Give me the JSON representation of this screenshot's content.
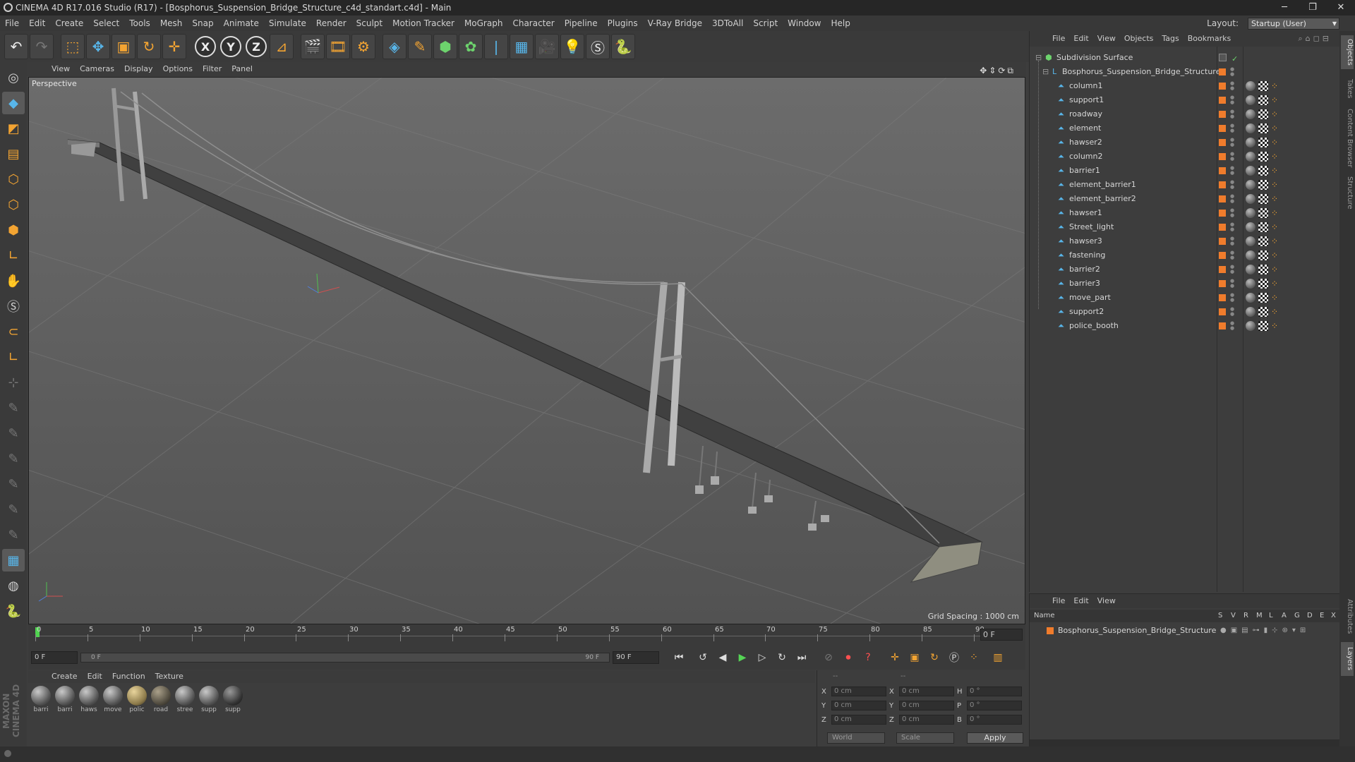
{
  "window": {
    "title": "CINEMA 4D R17.016 Studio (R17) - [Bosphorus_Suspension_Bridge_Structure_c4d_standart.c4d] - Main"
  },
  "menubar": {
    "items": [
      "File",
      "Edit",
      "Create",
      "Select",
      "Tools",
      "Mesh",
      "Snap",
      "Animate",
      "Simulate",
      "Render",
      "Sculpt",
      "Motion Tracker",
      "MoGraph",
      "Character",
      "Pipeline",
      "Plugins",
      "V-Ray Bridge",
      "3DToAll",
      "Script",
      "Window",
      "Help"
    ],
    "layout_label": "Layout:",
    "layout_value": "Startup (User)"
  },
  "toolbar": {
    "axis_x": "X",
    "axis_y": "Y",
    "axis_z": "Z"
  },
  "viewport": {
    "menu": [
      "View",
      "Cameras",
      "Display",
      "Options",
      "Filter",
      "Panel"
    ],
    "label": "Perspective",
    "grid_spacing": "Grid Spacing : 1000 cm"
  },
  "timeline": {
    "ticks": [
      "0",
      "5",
      "10",
      "15",
      "20",
      "25",
      "30",
      "35",
      "40",
      "45",
      "50",
      "55",
      "60",
      "65",
      "70",
      "75",
      "80",
      "85",
      "90"
    ],
    "frame_field": "0 F",
    "start_field": "0 F",
    "slider_start": "0 F",
    "slider_end": "90 F",
    "end_field": "90 F"
  },
  "materials": {
    "menu": [
      "Create",
      "Edit",
      "Function",
      "Texture"
    ],
    "items": [
      {
        "label": "barri",
        "kind": "grey"
      },
      {
        "label": "barri",
        "kind": "grey"
      },
      {
        "label": "haws",
        "kind": "grey"
      },
      {
        "label": "move",
        "kind": "grey"
      },
      {
        "label": "polic",
        "kind": "tan"
      },
      {
        "label": "road",
        "kind": "road"
      },
      {
        "label": "stree",
        "kind": "grey"
      },
      {
        "label": "supp",
        "kind": "grey"
      },
      {
        "label": "supp",
        "kind": "grey"
      }
    ]
  },
  "coords": {
    "header": "--",
    "rows": [
      {
        "a": "X",
        "av": "0 cm",
        "b": "X",
        "bv": "0 cm",
        "c": "H",
        "cv": "0 °"
      },
      {
        "a": "Y",
        "av": "0 cm",
        "b": "Y",
        "bv": "0 cm",
        "c": "P",
        "cv": "0 °"
      },
      {
        "a": "Z",
        "av": "0 cm",
        "b": "Z",
        "bv": "0 cm",
        "c": "B",
        "cv": "0 °"
      }
    ],
    "world": "World",
    "scale": "Scale",
    "apply": "Apply"
  },
  "objects": {
    "menu": [
      "File",
      "Edit",
      "View",
      "Objects",
      "Tags",
      "Bookmarks"
    ],
    "root": "Subdivision Surface",
    "group": "Bosphorus_Suspension_Bridge_Structure",
    "children": [
      "column1",
      "support1",
      "roadway",
      "element",
      "hawser2",
      "column2",
      "barrier1",
      "element_barrier1",
      "element_barrier2",
      "hawser1",
      "Street_light",
      "hawser3",
      "fastening",
      "barrier2",
      "barrier3",
      "move_part",
      "support2",
      "police_booth"
    ]
  },
  "layers": {
    "menu": [
      "File",
      "Edit",
      "View"
    ],
    "name_col": "Name",
    "cols": [
      "S",
      "V",
      "R",
      "M",
      "L",
      "A",
      "G",
      "D",
      "E",
      "X"
    ],
    "item": "Bosphorus_Suspension_Bridge_Structure"
  },
  "right_tabs": [
    "Objects",
    "Takes",
    "Content Browser",
    "Structure",
    "Attributes",
    "Layers"
  ]
}
